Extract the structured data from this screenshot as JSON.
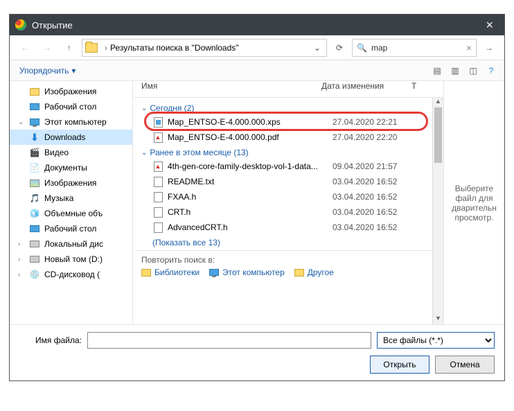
{
  "title": "Открытие",
  "breadcrumb": "Результаты поиска в \"Downloads\"",
  "search_value": "map",
  "toolbar": {
    "organize": "Упорядочить"
  },
  "tree": [
    {
      "icon": "folder",
      "label": "Изображения",
      "exp": ""
    },
    {
      "icon": "desktop",
      "label": "Рабочий стол",
      "exp": ""
    },
    {
      "icon": "pc",
      "label": "Этот компьютер",
      "exp": "v",
      "sel": false
    },
    {
      "icon": "down",
      "label": "Downloads",
      "exp": "",
      "sel": true
    },
    {
      "icon": "vid",
      "label": "Видео",
      "exp": ""
    },
    {
      "icon": "doc",
      "label": "Документы",
      "exp": ""
    },
    {
      "icon": "img",
      "label": "Изображения",
      "exp": ""
    },
    {
      "icon": "music",
      "label": "Музыка",
      "exp": ""
    },
    {
      "icon": "3d",
      "label": "Объемные объ",
      "exp": ""
    },
    {
      "icon": "desktop",
      "label": "Рабочий стол",
      "exp": ""
    },
    {
      "icon": "drive",
      "label": "Локальный дис",
      "exp": ">"
    },
    {
      "icon": "drive",
      "label": "Новый том (D:)",
      "exp": ">"
    },
    {
      "icon": "cd",
      "label": "CD-дисковод (",
      "exp": ">"
    }
  ],
  "cols": {
    "name": "Имя",
    "date": "Дата изменения",
    "type": "Т"
  },
  "groups": [
    {
      "label": "Сегодня (2)",
      "rows": [
        {
          "icon": "xps",
          "name": "Map_ENTSO-E-4.000.000.xps",
          "date": "27.04.2020 22:21"
        },
        {
          "icon": "pdf",
          "name": "Map_ENTSO-E-4.000.000.pdf",
          "date": "27.04.2020 22:20"
        }
      ]
    },
    {
      "label": "Ранее в этом месяце (13)",
      "rows": [
        {
          "icon": "pdf",
          "name": "4th-gen-core-family-desktop-vol-1-data...",
          "date": "09.04.2020 21:57"
        },
        {
          "icon": "txt",
          "name": "README.txt",
          "date": "03.04.2020 16:52"
        },
        {
          "icon": "txt",
          "name": "FXAA.h",
          "date": "03.04.2020 16:52"
        },
        {
          "icon": "txt",
          "name": "CRT.h",
          "date": "03.04.2020 16:52"
        },
        {
          "icon": "txt",
          "name": "AdvancedCRT.h",
          "date": "03.04.2020 16:52"
        }
      ],
      "more": "(Показать все 13)"
    }
  ],
  "repeat": {
    "label": "Повторить поиск в:",
    "locations": [
      "Библиотеки",
      "Этот компьютер",
      "Другое"
    ]
  },
  "side": "Выберите файл для дварительн просмотр.",
  "footer": {
    "filename_label": "Имя файла:",
    "filename_value": "",
    "filter": "Все файлы (*.*)",
    "open": "Открыть",
    "cancel": "Отмена"
  }
}
